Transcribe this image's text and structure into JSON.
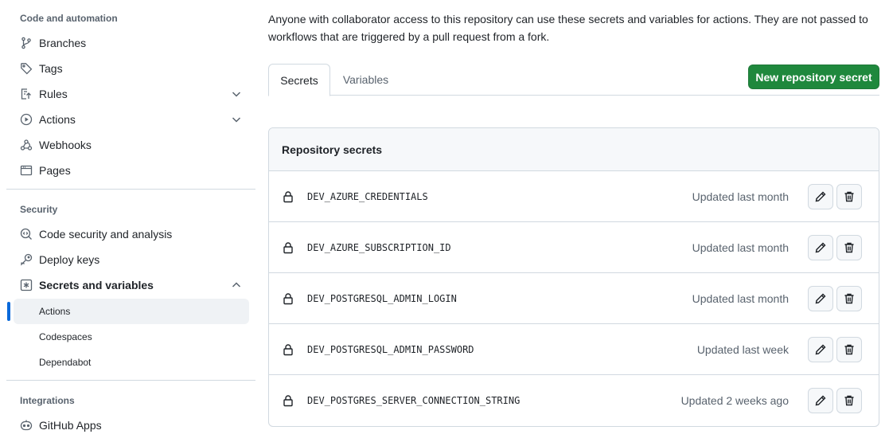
{
  "sidebar": {
    "code_section": {
      "title": "Code and automation",
      "items": [
        {
          "label": "Branches",
          "icon": "git-branch-icon"
        },
        {
          "label": "Tags",
          "icon": "tag-icon"
        },
        {
          "label": "Rules",
          "icon": "rules-icon",
          "expandable": true
        },
        {
          "label": "Actions",
          "icon": "play-icon",
          "expandable": true
        },
        {
          "label": "Webhooks",
          "icon": "webhook-icon"
        },
        {
          "label": "Pages",
          "icon": "browser-icon"
        }
      ]
    },
    "security_section": {
      "title": "Security",
      "items": [
        {
          "label": "Code security and analysis",
          "icon": "codescan-icon"
        },
        {
          "label": "Deploy keys",
          "icon": "key-icon"
        },
        {
          "label": "Secrets and variables",
          "icon": "asterisk-box-icon",
          "expanded": true
        }
      ],
      "subitems": [
        {
          "label": "Actions",
          "active": true
        },
        {
          "label": "Codespaces"
        },
        {
          "label": "Dependabot"
        }
      ]
    },
    "integrations_section": {
      "title": "Integrations",
      "items": [
        {
          "label": "GitHub Apps",
          "icon": "apps-icon"
        }
      ]
    }
  },
  "main": {
    "intro": "Anyone with collaborator access to this repository can use these secrets and variables for actions. They are not passed to workflows that are triggered by a pull request from a fork.",
    "tabs": [
      {
        "label": "Secrets",
        "selected": true
      },
      {
        "label": "Variables"
      }
    ],
    "new_button": "New repository secret",
    "secrets_header": "Repository secrets",
    "secrets": [
      {
        "name": "DEV_AZURE_CREDENTIALS",
        "updated": "Updated last month"
      },
      {
        "name": "DEV_AZURE_SUBSCRIPTION_ID",
        "updated": "Updated last month"
      },
      {
        "name": "DEV_POSTGRESQL_ADMIN_LOGIN",
        "updated": "Updated last month"
      },
      {
        "name": "DEV_POSTGRESQL_ADMIN_PASSWORD",
        "updated": "Updated last week"
      },
      {
        "name": "DEV_POSTGRES_SERVER_CONNECTION_STRING",
        "updated": "Updated 2 weeks ago"
      }
    ]
  },
  "colors": {
    "accent": "#0969da",
    "primary_button": "#1f883d",
    "border": "#d1d9e0",
    "muted_text": "#59636e"
  }
}
